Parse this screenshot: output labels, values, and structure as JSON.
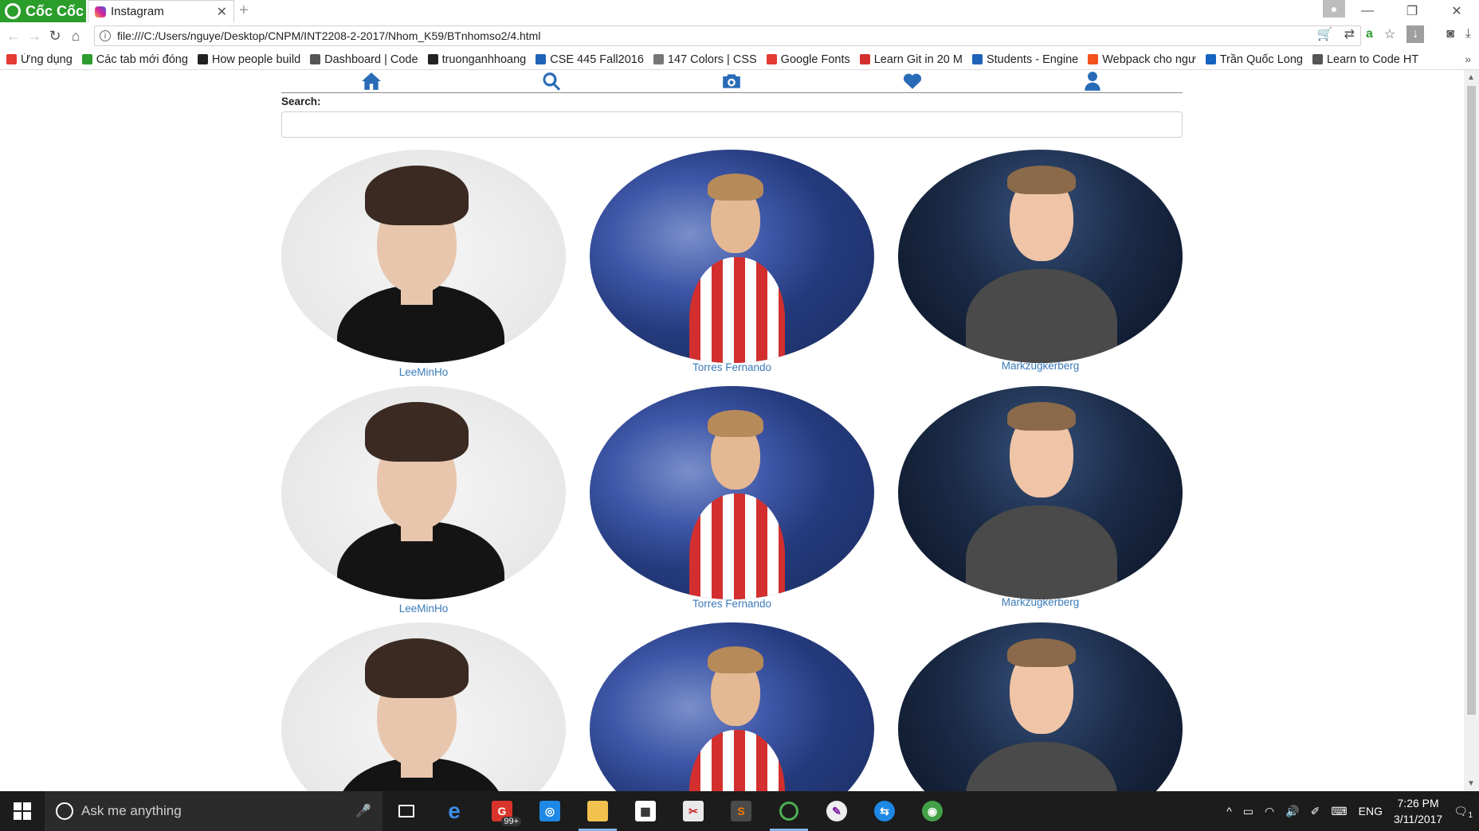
{
  "browser": {
    "brand": "Cốc Cốc",
    "tab_title": "Instagram",
    "url": "file:///C:/Users/nguye/Desktop/CNPM/INT2208-2-2017/Nhom_K59/BTnhomso2/4.html",
    "bookmarks": [
      {
        "label": "Ứng dụng",
        "color": "#e53935"
      },
      {
        "label": "Các tab mới đóng",
        "color": "#2e9c2e"
      },
      {
        "label": "How people build",
        "color": "#222222"
      },
      {
        "label": "Dashboard | Code",
        "color": "#555555"
      },
      {
        "label": "truonganhhoang",
        "color": "#222222"
      },
      {
        "label": "CSE 445 Fall2016",
        "color": "#1e63b8"
      },
      {
        "label": "147 Colors | CSS",
        "color": "#777777"
      },
      {
        "label": "Google Fonts",
        "color": "#e53935"
      },
      {
        "label": "Learn Git in 20 M",
        "color": "#d32f2f"
      },
      {
        "label": "Students - Engine",
        "color": "#1e63b8"
      },
      {
        "label": "Webpack cho ngư",
        "color": "#f4511e"
      },
      {
        "label": "Trần Quốc Long",
        "color": "#1565c0"
      },
      {
        "label": "Learn to Code HT",
        "color": "#555555"
      }
    ]
  },
  "page": {
    "nav_icons": [
      "home-icon",
      "search-icon",
      "camera-icon",
      "heart-icon",
      "user-icon"
    ],
    "accent_color": "#2a6bb7",
    "search_label": "Search:",
    "search_value": "",
    "profiles": [
      {
        "name": "LeeMinHo",
        "style": "lee"
      },
      {
        "name": "Torres Fernando",
        "style": "torres"
      },
      {
        "name": "Markzugkerberg",
        "style": "mark"
      },
      {
        "name": "LeeMinHo",
        "style": "lee"
      },
      {
        "name": "Torres Fernando",
        "style": "torres"
      },
      {
        "name": "Markzugkerberg",
        "style": "mark"
      },
      {
        "name": "",
        "style": "lee"
      },
      {
        "name": "",
        "style": "torres"
      },
      {
        "name": "",
        "style": "mark"
      }
    ]
  },
  "taskbar": {
    "search_placeholder": "Ask me anything",
    "badge": "99+",
    "language": "ENG",
    "time": "7:26 PM",
    "date": "3/11/2017",
    "notifications": "1"
  }
}
